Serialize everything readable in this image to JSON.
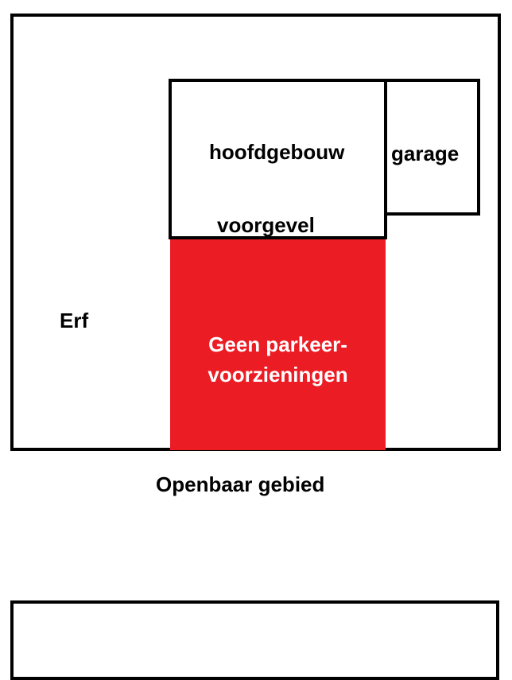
{
  "labels": {
    "hoofdgebouw": "hoofdgebouw",
    "garage": "garage",
    "voorgevel": "voorgevel",
    "erf": "Erf",
    "no_parking_line1": "Geen parkeer-",
    "no_parking_line2": "voorzieningen",
    "openbaar": "Openbaar gebied"
  },
  "colors": {
    "no_parking_fill": "#ec1c24",
    "outline": "#000000",
    "background": "#ffffff"
  }
}
